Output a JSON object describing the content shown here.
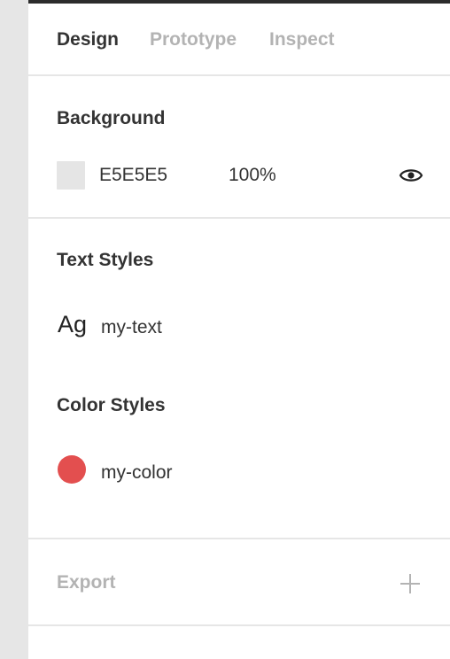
{
  "tabs": [
    {
      "label": "Design",
      "active": true
    },
    {
      "label": "Prototype",
      "active": false
    },
    {
      "label": "Inspect",
      "active": false
    }
  ],
  "background": {
    "title": "Background",
    "color_hex": "E5E5E5",
    "swatch_color": "#E5E5E5",
    "opacity": "100%",
    "visibility_icon": "eye-icon"
  },
  "text_styles": {
    "title": "Text Styles",
    "preview_glyph": "Ag",
    "items": [
      {
        "label": "my-text"
      }
    ]
  },
  "color_styles": {
    "title": "Color Styles",
    "items": [
      {
        "label": "my-color",
        "color": "#E34F4F"
      }
    ]
  },
  "export": {
    "title": "Export",
    "add_icon": "plus-icon"
  }
}
